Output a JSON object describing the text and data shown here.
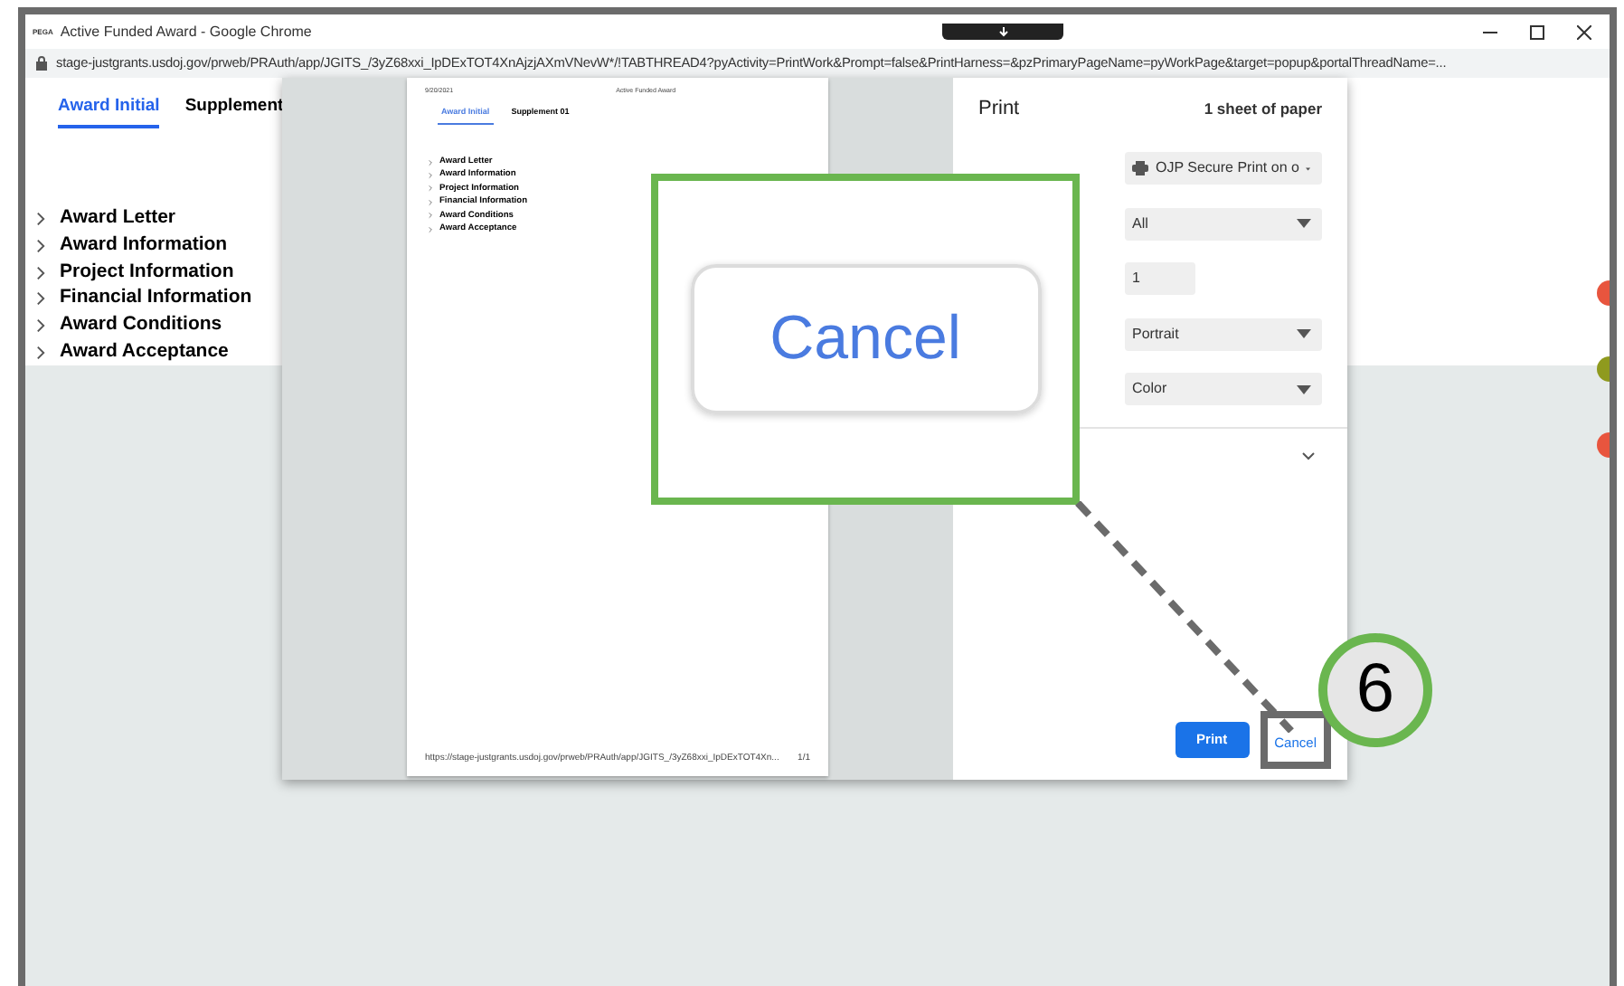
{
  "window": {
    "favicon": "PEGA",
    "title": "Active Funded Award - Google Chrome",
    "url": "stage-justgrants.usdoj.gov/prweb/PRAuth/app/JGITS_/3yZ68xxi_IpDExTOT4XnAjzjAXmVNevW*/!TABTHREAD4?pyActivity=PrintWork&Prompt=false&PrintHarness=&pzPrimaryPageName=pyWorkPage&target=popup&portalThreadName=..."
  },
  "page": {
    "tabs": [
      {
        "label": "Award Initial",
        "selected": true
      },
      {
        "label": "Supplement",
        "selected": false
      }
    ],
    "sections": [
      "Award Letter",
      "Award Information",
      "Project Information",
      "Financial Information",
      "Award Conditions",
      "Award Acceptance"
    ]
  },
  "print_dialog": {
    "preview": {
      "date": "9/20/2021",
      "title": "Active Funded Award",
      "tabs": [
        {
          "label": "Award Initial",
          "selected": true
        },
        {
          "label": "Supplement 01",
          "selected": false
        }
      ],
      "sections": [
        "Award Letter",
        "Award Information",
        "Project Information",
        "Financial Information",
        "Award Conditions",
        "Award Acceptance"
      ],
      "footer_url": "https://stage-justgrants.usdoj.gov/prweb/PRAuth/app/JGITS_/3yZ68xxi_IpDExTOT4Xn...",
      "page_number": "1/1"
    },
    "title": "Print",
    "sheets": "1 sheet of paper",
    "settings": [
      {
        "kind": "destination",
        "value": "OJP Secure Print on o"
      },
      {
        "kind": "dropdown",
        "value": "All"
      },
      {
        "kind": "number",
        "value": "1"
      },
      {
        "kind": "dropdown",
        "value": "Portrait"
      },
      {
        "kind": "dropdown",
        "value": "Color"
      }
    ],
    "buttons": [
      {
        "kind": "primary",
        "label": "Print"
      },
      {
        "kind": "secondary",
        "label": "Cancel"
      }
    ]
  },
  "callout": {
    "zoomed_label": "Cancel",
    "step": "6"
  }
}
